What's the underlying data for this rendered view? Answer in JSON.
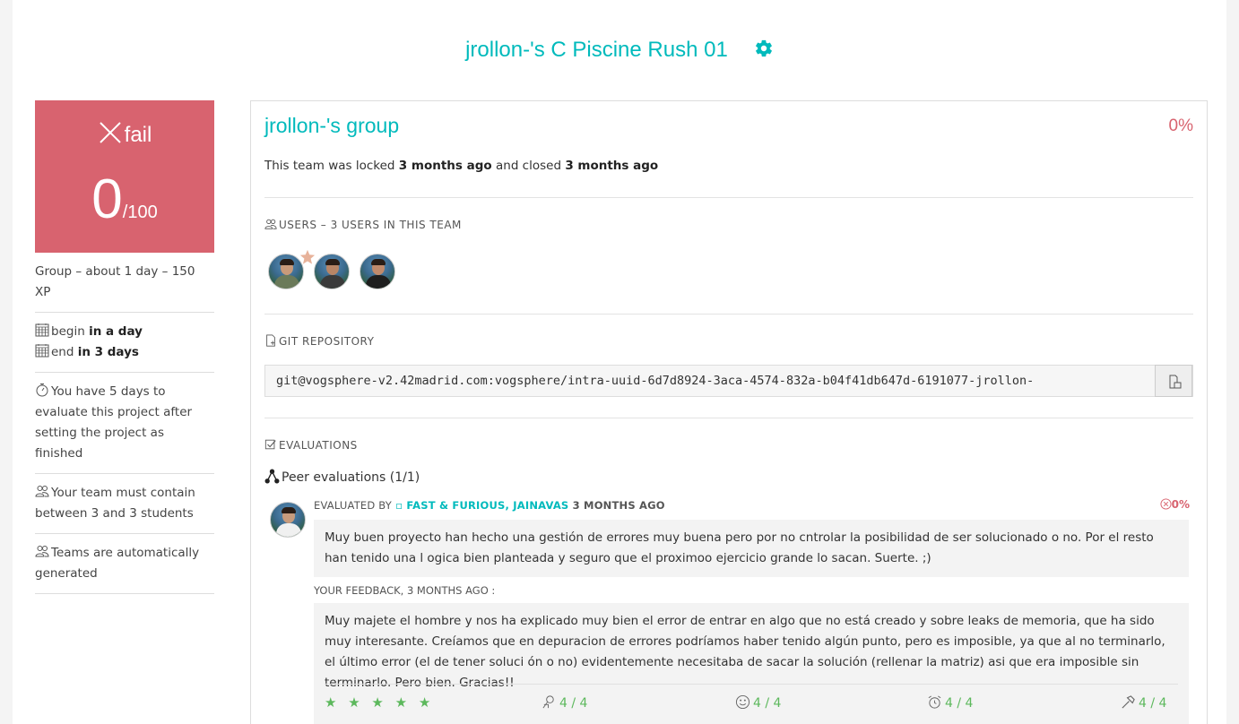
{
  "header": {
    "title": "jrollon-'s C Piscine Rush 01"
  },
  "mark": {
    "status": "fail",
    "score": "0",
    "out_of": "/100",
    "color": "#d8636f"
  },
  "left": {
    "summary": "Group – about 1 day – 150 XP",
    "begin_label": "begin",
    "begin_value": "in a day",
    "end_label": "end",
    "end_value": "in 3 days",
    "evaluate_note": "You have 5 days to evaluate this project after setting the project as finished",
    "team_size_note": "Your team must contain between 3 and 3 students",
    "auto_note": "Teams are automatically generated"
  },
  "panel": {
    "group_name": "jrollon-'s group",
    "group_pct": "0%",
    "locked_prefix": "This team was locked",
    "locked_time": "3 months ago",
    "closed_prefix": "and closed",
    "closed_time": "3 months ago",
    "users_heading": "USERS – 3 USERS IN THIS TEAM",
    "git_heading": "GIT REPOSITORY",
    "git_url": "git@vogsphere-v2.42madrid.com:vogsphere/intra-uuid-6d7d8924-3aca-4574-832a-b04f41db647d-6191077-jrollon-",
    "evaluations_heading": "EVALUATIONS",
    "peer_evaluations": "Peer evaluations (1/1)"
  },
  "evaluation": {
    "evaluated_by": "EVALUATED BY",
    "team": "FAST & FURIOUS, JAINAVAS",
    "time": "3 MONTHS AGO",
    "pct": "0%",
    "comment": "Muy buen proyecto han hecho una gestión de errores muy buena pero por no cntrolar la posibilidad de ser solucionado o no. Por el resto han tenido una l ogica bien planteada y seguro que el proximoo ejercicio grande lo sacan. Suerte. ;)",
    "feedback_label": "YOUR FEEDBACK, 3 MONTHS AGO :",
    "feedback": "Muy majete el hombre y nos ha explicado muy bien el error de entrar en algo que no está creado y sobre leaks de memoria, que ha sido muy interesante. Creíamos que en depuracion de errores podríamos haber tenido algún punto, pero es imposible, ya que al no terminarlo, el último error (el de tener soluci ón o no) evidentemente necesitaba de sacar la solución (rellenar la matriz) asi que era imposible sin terminarlo. Pero bien. Gracias!!",
    "stars": "★ ★ ★ ★ ★",
    "ratings": [
      "4 / 4",
      "4 / 4",
      "4 / 4",
      "4 / 4"
    ]
  },
  "colors": {
    "accent": "#00babc",
    "fail": "#d8636f",
    "good": "#5cb85c"
  }
}
